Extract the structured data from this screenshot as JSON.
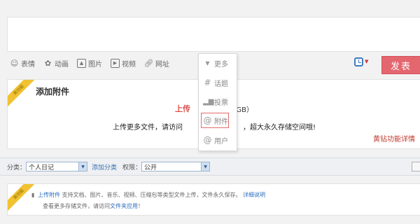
{
  "toolbar": {
    "items": [
      {
        "label": "表情",
        "icon": "smile-icon"
      },
      {
        "label": "动画",
        "icon": "animation-icon"
      },
      {
        "label": "图片",
        "icon": "image-icon"
      },
      {
        "label": "视频",
        "icon": "video-icon"
      },
      {
        "label": "网址",
        "icon": "link-icon"
      }
    ],
    "publish_label": "发表"
  },
  "more_menu": {
    "header": "更多",
    "items": [
      {
        "label": "话题",
        "icon": "hashtag-icon"
      },
      {
        "label": "投票",
        "icon": "poll-icon"
      },
      {
        "label": "附件",
        "icon": "paperclip-icon",
        "selected": true
      },
      {
        "label": "用户",
        "icon": "at-icon"
      }
    ]
  },
  "attachment": {
    "ribbon": "新功能",
    "title": "添加附件",
    "upload_link": "上传",
    "quota": "8GB）",
    "line2_left": "上传更多文件，请访问",
    "line2_right": "，超大永久存储空间哦!",
    "feature_link": "黄钻功能详情"
  },
  "options": {
    "category_label": "分类：",
    "category_value": "个人日记",
    "add_category": "添加分类",
    "permission_label": "权限：",
    "permission_value": "公开"
  },
  "tip": {
    "ribbon": "新功能",
    "line1_link": "上传附件",
    "line1_text": "支持文档、图片、音乐、视频、压缩包等类型文件上传，文件永久保存。",
    "line1_detail": "详细说明",
    "line2_text": "查看更多存储文件，请访问",
    "line2_link": "文件夹应用",
    "line2_end": "！"
  },
  "colors": {
    "publish": "#e4666e",
    "link": "#2c6dbf",
    "highlight": "#d9534f"
  }
}
